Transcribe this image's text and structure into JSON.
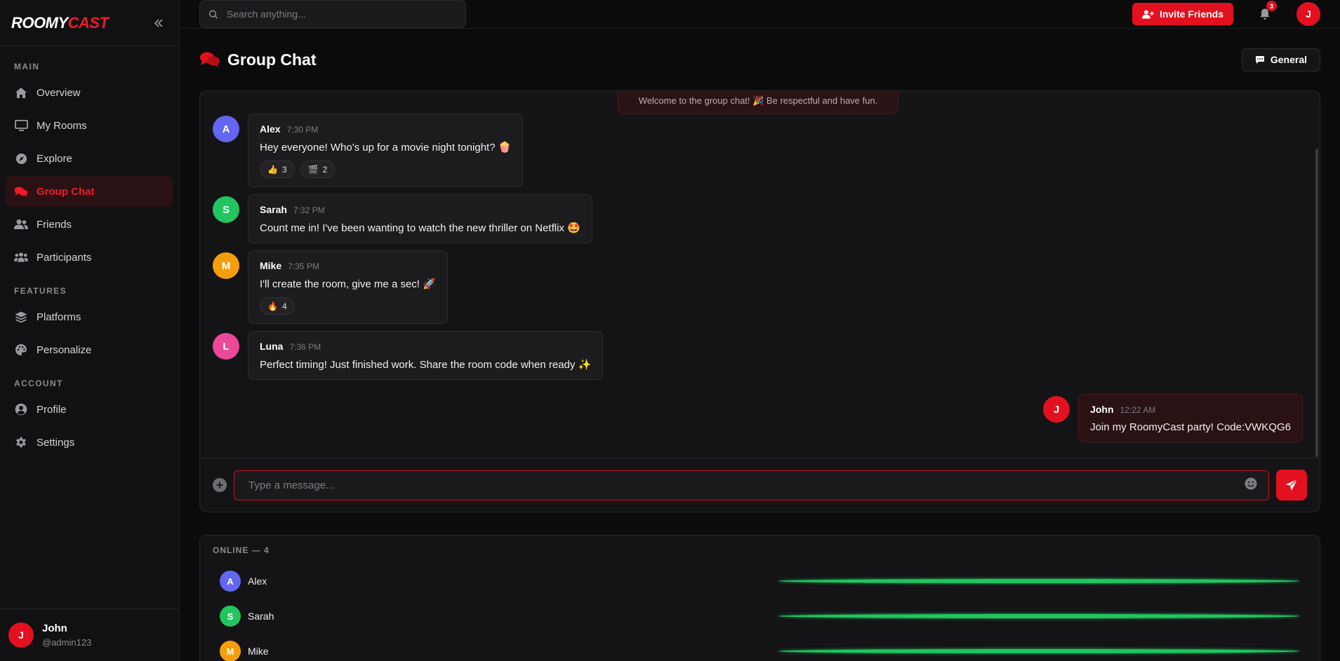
{
  "brand": {
    "part1": "ROOMY",
    "part2": "CAST"
  },
  "colors": {
    "accent": "#e3101f",
    "online": "#22c55e"
  },
  "sidebar": {
    "sections": [
      {
        "label": "MAIN",
        "items": [
          {
            "label": "Overview",
            "icon": "home-icon"
          },
          {
            "label": "My Rooms",
            "icon": "monitor-icon"
          },
          {
            "label": "Explore",
            "icon": "compass-icon"
          },
          {
            "label": "Group Chat",
            "icon": "chat-icon",
            "active": true
          },
          {
            "label": "Friends",
            "icon": "users-icon"
          },
          {
            "label": "Participants",
            "icon": "group-icon"
          }
        ]
      },
      {
        "label": "FEATURES",
        "items": [
          {
            "label": "Platforms",
            "icon": "layers-icon"
          },
          {
            "label": "Personalize",
            "icon": "palette-icon"
          }
        ]
      },
      {
        "label": "ACCOUNT",
        "items": [
          {
            "label": "Profile",
            "icon": "user-circle-icon"
          },
          {
            "label": "Settings",
            "icon": "gear-icon"
          }
        ]
      }
    ],
    "user": {
      "initial": "J",
      "name": "John",
      "handle": "@admin123"
    }
  },
  "topbar": {
    "search_placeholder": "Search anything...",
    "invite_label": "Invite Friends",
    "notification_count": "3",
    "avatar_initial": "J"
  },
  "page": {
    "title": "Group Chat",
    "channel_label": "General"
  },
  "chat": {
    "welcome": "Welcome to the group chat! 🎉 Be respectful and have fun.",
    "messages": [
      {
        "initial": "A",
        "author": "Alex",
        "time": "7:30 PM",
        "text": "Hey everyone! Who's up for a movie night tonight? 🍿",
        "color": "#6366f1",
        "reactions": [
          {
            "emoji": "👍",
            "count": "3"
          },
          {
            "emoji": "🎬",
            "count": "2"
          }
        ]
      },
      {
        "initial": "S",
        "author": "Sarah",
        "time": "7:32 PM",
        "text": "Count me in! I've been wanting to watch the new thriller on Netflix 🤩",
        "color": "#22c55e",
        "reactions": []
      },
      {
        "initial": "M",
        "author": "Mike",
        "time": "7:35 PM",
        "text": "I'll create the room, give me a sec! 🚀",
        "color": "#f59e0b",
        "reactions": [
          {
            "emoji": "🔥",
            "count": "4"
          }
        ]
      },
      {
        "initial": "L",
        "author": "Luna",
        "time": "7:36 PM",
        "text": "Perfect timing! Just finished work. Share the room code when ready ✨",
        "color": "#ec4899",
        "reactions": []
      },
      {
        "initial": "J",
        "author": "John",
        "time": "12:22 AM",
        "text": "Join my RoomyCast party! Code:VWKQG6",
        "color": "#e3101f",
        "own": true,
        "reactions": []
      }
    ],
    "input_placeholder": "Type a message..."
  },
  "online": {
    "title": "ONLINE — 4",
    "users": [
      {
        "initial": "A",
        "name": "Alex",
        "color": "#6366f1"
      },
      {
        "initial": "S",
        "name": "Sarah",
        "color": "#22c55e"
      },
      {
        "initial": "M",
        "name": "Mike",
        "color": "#f59e0b"
      }
    ]
  }
}
